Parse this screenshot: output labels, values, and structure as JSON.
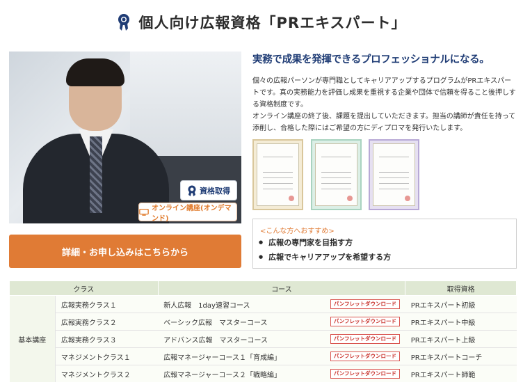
{
  "page": {
    "title": "個人向け広報資格「PRエキスパート」"
  },
  "hero": {
    "badge_certification": "資格取得",
    "badge_online": "オンライン講座(オンデマンド)"
  },
  "cta": {
    "label": "詳細・お申し込みはこちらから"
  },
  "intro": {
    "headline": "実務で成果を発揮できるプロフェッショナルになる。",
    "paragraph1": "個々の広報パーソンが専門職としてキャリアアップするプログラムがPRエキスパートです。真の実務能力を評価し成果を重視する企業や団体で信頼を得ること後押しする資格制度です。",
    "paragraph2": "オンライン講座の終了後、課題を提出していただきます。担当の講師が責任を持って添削し、合格した際にはご希望の方にディプロマを発行いたします。"
  },
  "recommend": {
    "title": "<こんな方へおすすめ>",
    "items": [
      "広報の専門家を目指す方",
      "広報でキャリアアップを希望する方"
    ]
  },
  "table": {
    "headers": [
      "クラス",
      "コース",
      "取得資格"
    ],
    "category": "基本講座",
    "download_label": "パンフレットダウンロード",
    "rows": [
      {
        "class": "広報実務クラス１",
        "course": "新人広報　1day速習コース",
        "qualification": "PRエキスパート初級"
      },
      {
        "class": "広報実務クラス２",
        "course": "ベーシック広報　マスターコース",
        "qualification": "PRエキスパート中級"
      },
      {
        "class": "広報実務クラス３",
        "course": "アドバンス広報　マスターコース",
        "qualification": "PRエキスパート上級"
      },
      {
        "class": "マネジメントクラス１",
        "course": "広報マネージャーコース１「育成編」",
        "qualification": "PRエキスパートコーチ"
      },
      {
        "class": "マネジメントクラス２",
        "course": "広報マネージャーコース２「戦略編」",
        "qualification": "PRエキスパート師範"
      }
    ]
  },
  "colors": {
    "navy": "#1f3c75",
    "accent_orange": "#e07b35",
    "table_header": "#dfe8d3"
  }
}
